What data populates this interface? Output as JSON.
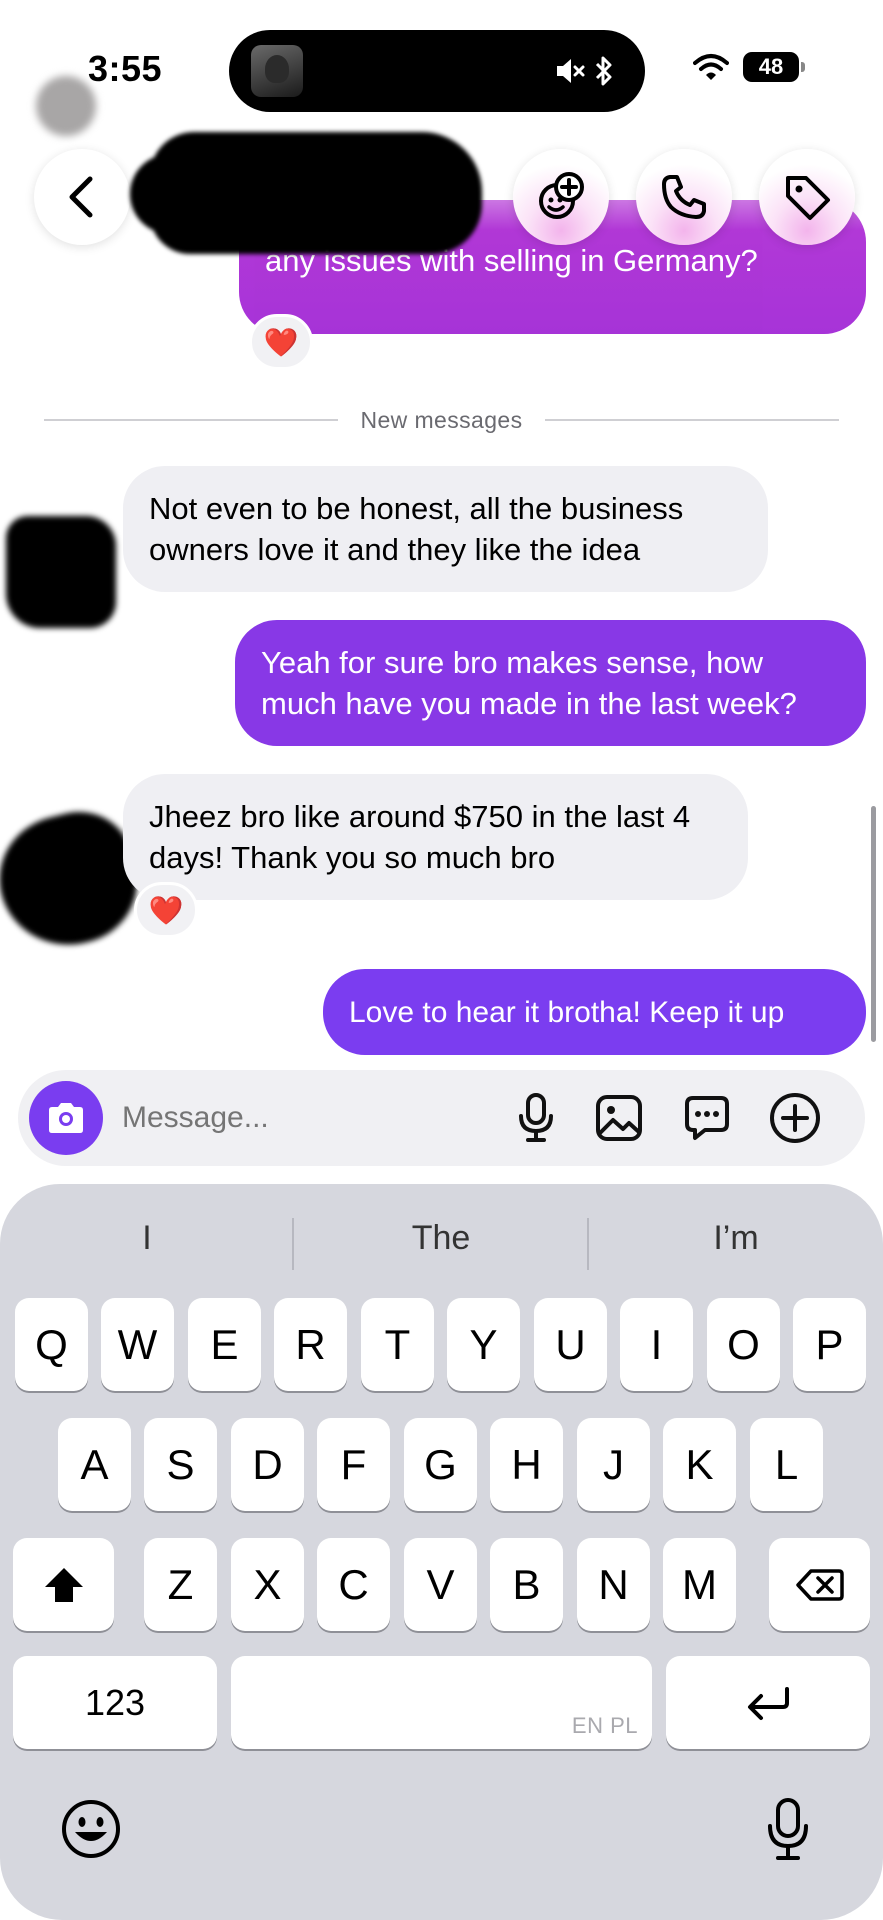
{
  "status_bar": {
    "time": "3:55",
    "battery": "48",
    "icons": [
      "speaker-muted-icon",
      "bluetooth-icon",
      "wifi-icon",
      "battery-icon"
    ]
  },
  "header": {
    "icons": [
      "back-icon",
      "effects-icon",
      "phone-icon",
      "tag-icon"
    ]
  },
  "chat": {
    "messages": [
      {
        "from": "me",
        "text": "any issues with selling in Germany?",
        "reaction": "❤️"
      },
      {
        "from": "them",
        "text": "Not even to be honest, all the business owners love it and they like the idea"
      },
      {
        "from": "me",
        "text": "Yeah for sure bro makes sense, how much have you made in the last week?"
      },
      {
        "from": "them",
        "text": "Jheez bro like around $750 in the last 4 days! Thank you so much bro",
        "reaction": "❤️"
      },
      {
        "from": "me",
        "text": "Love to hear it brotha! Keep it up"
      }
    ],
    "divider_label": "New messages"
  },
  "composer": {
    "placeholder": "Message...",
    "icons": [
      "camera-icon",
      "microphone-icon",
      "image-icon",
      "sticker-icon",
      "plus-icon"
    ]
  },
  "keyboard": {
    "suggestions": [
      "I",
      "The",
      "I’m"
    ],
    "rows": [
      [
        "Q",
        "W",
        "E",
        "R",
        "T",
        "Y",
        "U",
        "I",
        "O",
        "P"
      ],
      [
        "A",
        "S",
        "D",
        "F",
        "G",
        "H",
        "J",
        "K",
        "L"
      ],
      [
        "Z",
        "X",
        "C",
        "V",
        "B",
        "N",
        "M"
      ]
    ],
    "numbers_label": "123",
    "space_hint": "EN PL"
  },
  "colors": {
    "outgoing_bubble": "#8838e6",
    "outgoing_bubble_alt": "#7b3df0",
    "incoming_bubble": "#efeff3",
    "accent": "#7a3df0",
    "heart": "#ef1d35",
    "keyboard_bg": "#d6d7de"
  }
}
